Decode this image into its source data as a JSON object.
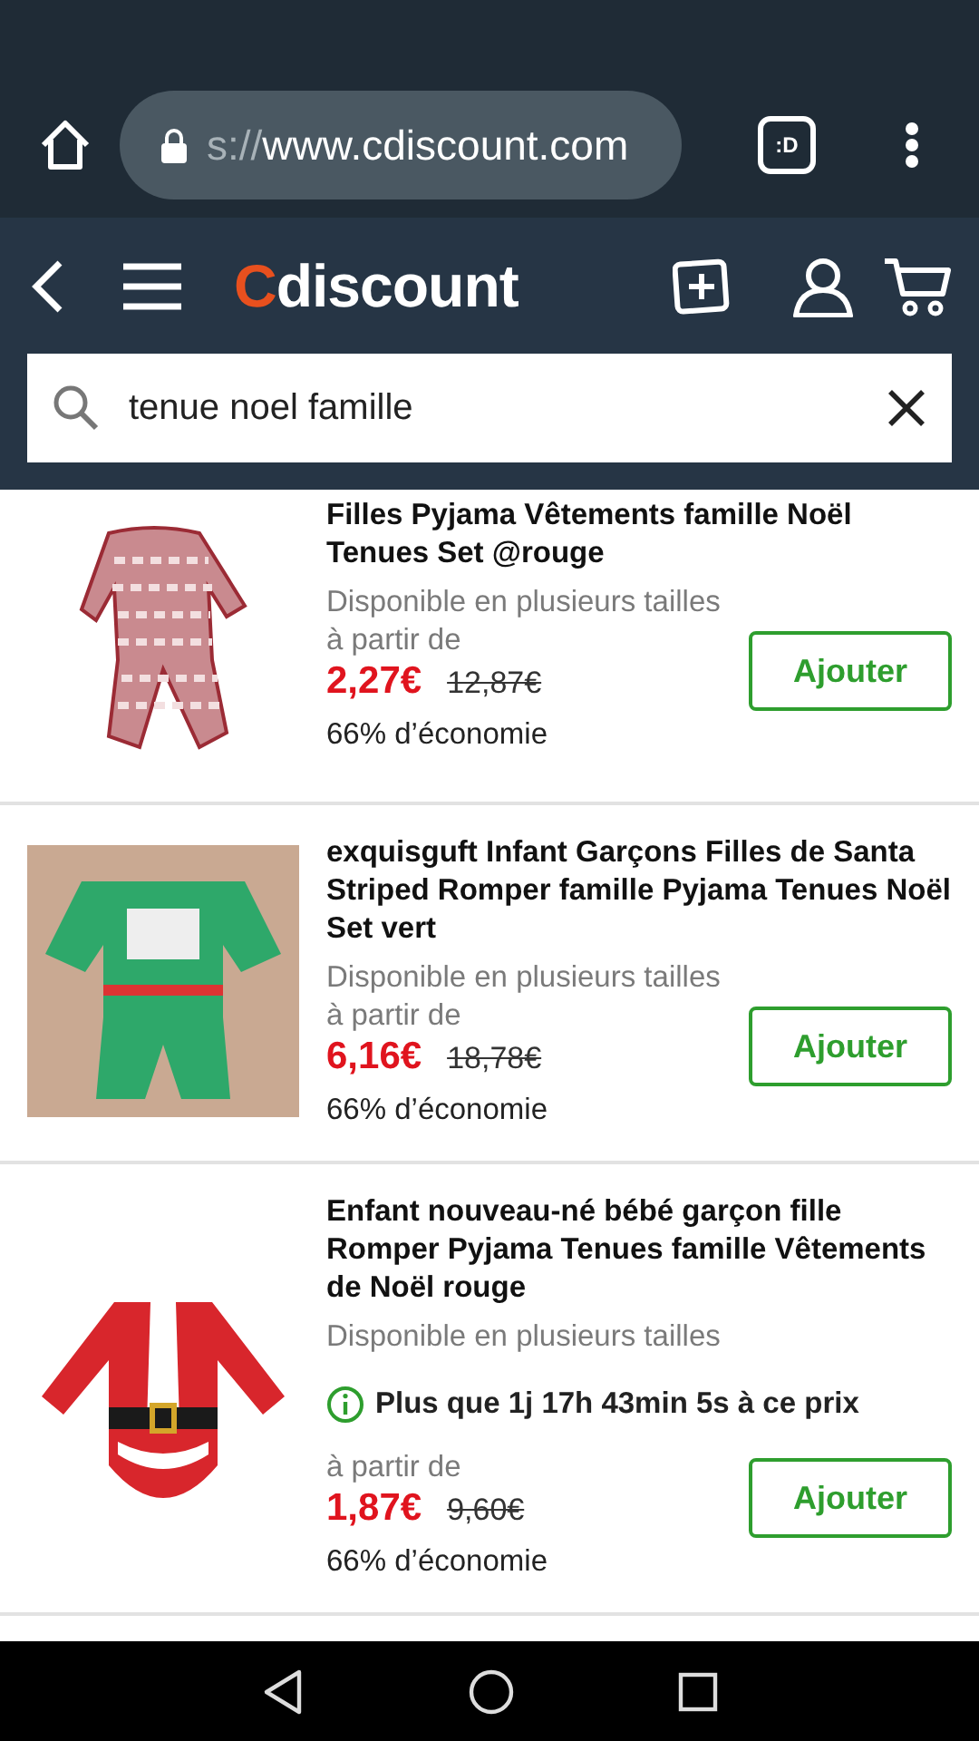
{
  "browser": {
    "url_faded": "s://",
    "url": "www.cdiscount.com",
    "tab_button": ":D"
  },
  "header": {
    "logo": "Cdiscount",
    "search": {
      "value": "tenue noel famille"
    }
  },
  "products": [
    {
      "kind": "pajama",
      "title": "Filles Pyjama Vêtements famille Noël Tenues Set @rouge",
      "availability": "Disponible en plusieurs tailles",
      "price_prefix": "à partir de",
      "price": "2,27€",
      "old_price": "12,87€",
      "savings": "66% d’économie",
      "button": "Ajouter"
    },
    {
      "kind": "romper",
      "title": "exquisguft Infant Garçons Filles de Santa Striped Romper famille Pyjama Tenues Noël Set vert",
      "availability": "Disponible en plusieurs tailles",
      "price_prefix": "à partir de",
      "price": "6,16€",
      "old_price": "18,78€",
      "savings": "66% d’économie",
      "button": "Ajouter"
    },
    {
      "kind": "bodysuit",
      "title": "Enfant nouveau-né bébé garçon fille Romper Pyjama Tenues famille Vêtements de Noël rouge",
      "availability": "Disponible en plusieurs tailles",
      "timer": "Plus que 1j 17h 43min 5s à ce prix",
      "price_prefix": "à partir de",
      "price": "1,87€",
      "old_price": "9,60€",
      "savings": "66% d’économie",
      "button": "Ajouter"
    }
  ]
}
